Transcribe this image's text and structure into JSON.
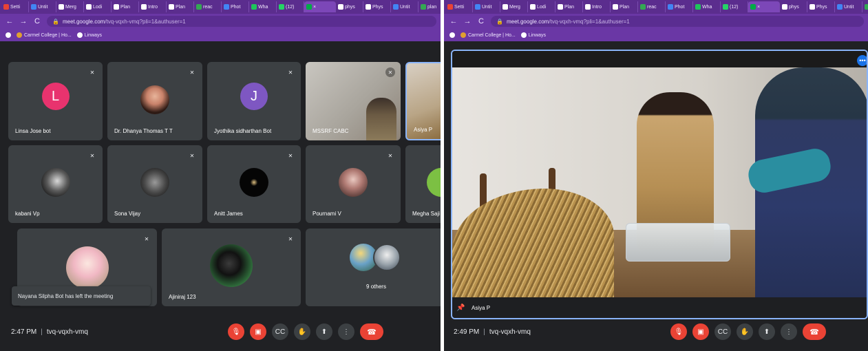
{
  "left": {
    "tabs": [
      {
        "label": "Setti",
        "icon": "gmail-icon",
        "color": "#ea4335"
      },
      {
        "label": "Untit",
        "icon": "docs-icon",
        "color": "#4285f4"
      },
      {
        "label": "Merg",
        "icon": "web-icon",
        "color": "#ffffff"
      },
      {
        "label": "Lodi",
        "icon": "web-icon",
        "color": "#ffffff"
      },
      {
        "label": "Plan",
        "icon": "web-icon",
        "color": "#ffffff"
      },
      {
        "label": "Intro",
        "icon": "web-icon",
        "color": "#ffffff"
      },
      {
        "label": "Plan",
        "icon": "web-icon",
        "color": "#ffffff"
      },
      {
        "label": "reac",
        "icon": "google-icon",
        "color": "#34a853"
      },
      {
        "label": "Phot",
        "icon": "photos-icon",
        "color": "#4285f4"
      },
      {
        "label": "Wha",
        "icon": "whatsapp-icon",
        "color": "#1ec55b"
      },
      {
        "label": "(12)",
        "icon": "whatsapp-icon",
        "color": "#25d366"
      },
      {
        "label": "×",
        "icon": "meet-icon",
        "color": "#00ac47",
        "active": true
      },
      {
        "label": "phys",
        "icon": "web-icon",
        "color": "#ffffff"
      },
      {
        "label": "Phys",
        "icon": "web-icon",
        "color": "#ffffff"
      },
      {
        "label": "Untit",
        "icon": "docs-icon",
        "color": "#4285f4"
      },
      {
        "label": "plan",
        "icon": "google-icon",
        "color": "#34a853"
      }
    ],
    "url_main": "meet.google.com",
    "url_path": "/tvq-vqxh-vmq?pli=1&authuser=1",
    "bookmarks": [
      "Carmel College | Ho...",
      "Linways"
    ],
    "participants": [
      {
        "name": "Linsa Jose bot",
        "type": "letter",
        "letter": "L",
        "color": "#e8336e"
      },
      {
        "name": "Dr. Dhanya Thomas T T",
        "type": "photo",
        "color": "#c9826a"
      },
      {
        "name": "Jyothika sidharthan Bot",
        "type": "letter",
        "letter": "J",
        "color": "#7e57c2"
      },
      {
        "name": "MSSRF CABC",
        "type": "video"
      },
      {
        "name": "Asiya P",
        "type": "hay"
      },
      {
        "name": "kabani Vp",
        "type": "photo",
        "color": "#5a5a5a"
      },
      {
        "name": "Sona Vijay",
        "type": "photo",
        "color": "#4a4a4a"
      },
      {
        "name": "Anitt James",
        "type": "photo",
        "color": "#050505"
      },
      {
        "name": "Pournami V",
        "type": "photo",
        "color": "#b07a73"
      },
      {
        "name": "Megha Saji",
        "type": "photo",
        "color": "#7cc043"
      },
      {
        "name": "Nayana Silpha Bot",
        "type": "photo",
        "color": "#f1b8c4"
      },
      {
        "name": "Ajiniraj 123",
        "type": "photo",
        "color": "#2e6b3a"
      }
    ],
    "toast": "Nayana Silpha Bot has left the meeting",
    "others_label": "9 others",
    "time": "2:47 PM",
    "meeting_code": "tvq-vqxh-vmq"
  },
  "right": {
    "time": "2:49 PM",
    "meeting_code": "tvq-vqxh-vmq",
    "pinned_name": "Asiya P"
  },
  "controls": [
    {
      "name": "mic-off-button",
      "icon": "mic-off-icon",
      "glyph": "🎙",
      "style": "red"
    },
    {
      "name": "camera-off-button",
      "icon": "camera-off-icon",
      "glyph": "▣",
      "style": "red"
    },
    {
      "name": "captions-button",
      "icon": "captions-icon",
      "glyph": "CC",
      "style": "normal"
    },
    {
      "name": "raise-hand-button",
      "icon": "hand-icon",
      "glyph": "✋",
      "style": "normal"
    },
    {
      "name": "present-button",
      "icon": "present-icon",
      "glyph": "⬆",
      "style": "normal"
    },
    {
      "name": "more-options-button",
      "icon": "more-vert-icon",
      "glyph": "⋮",
      "style": "normal"
    },
    {
      "name": "leave-call-button",
      "icon": "call-end-icon",
      "glyph": "☎",
      "style": "end"
    }
  ],
  "separator": "|"
}
